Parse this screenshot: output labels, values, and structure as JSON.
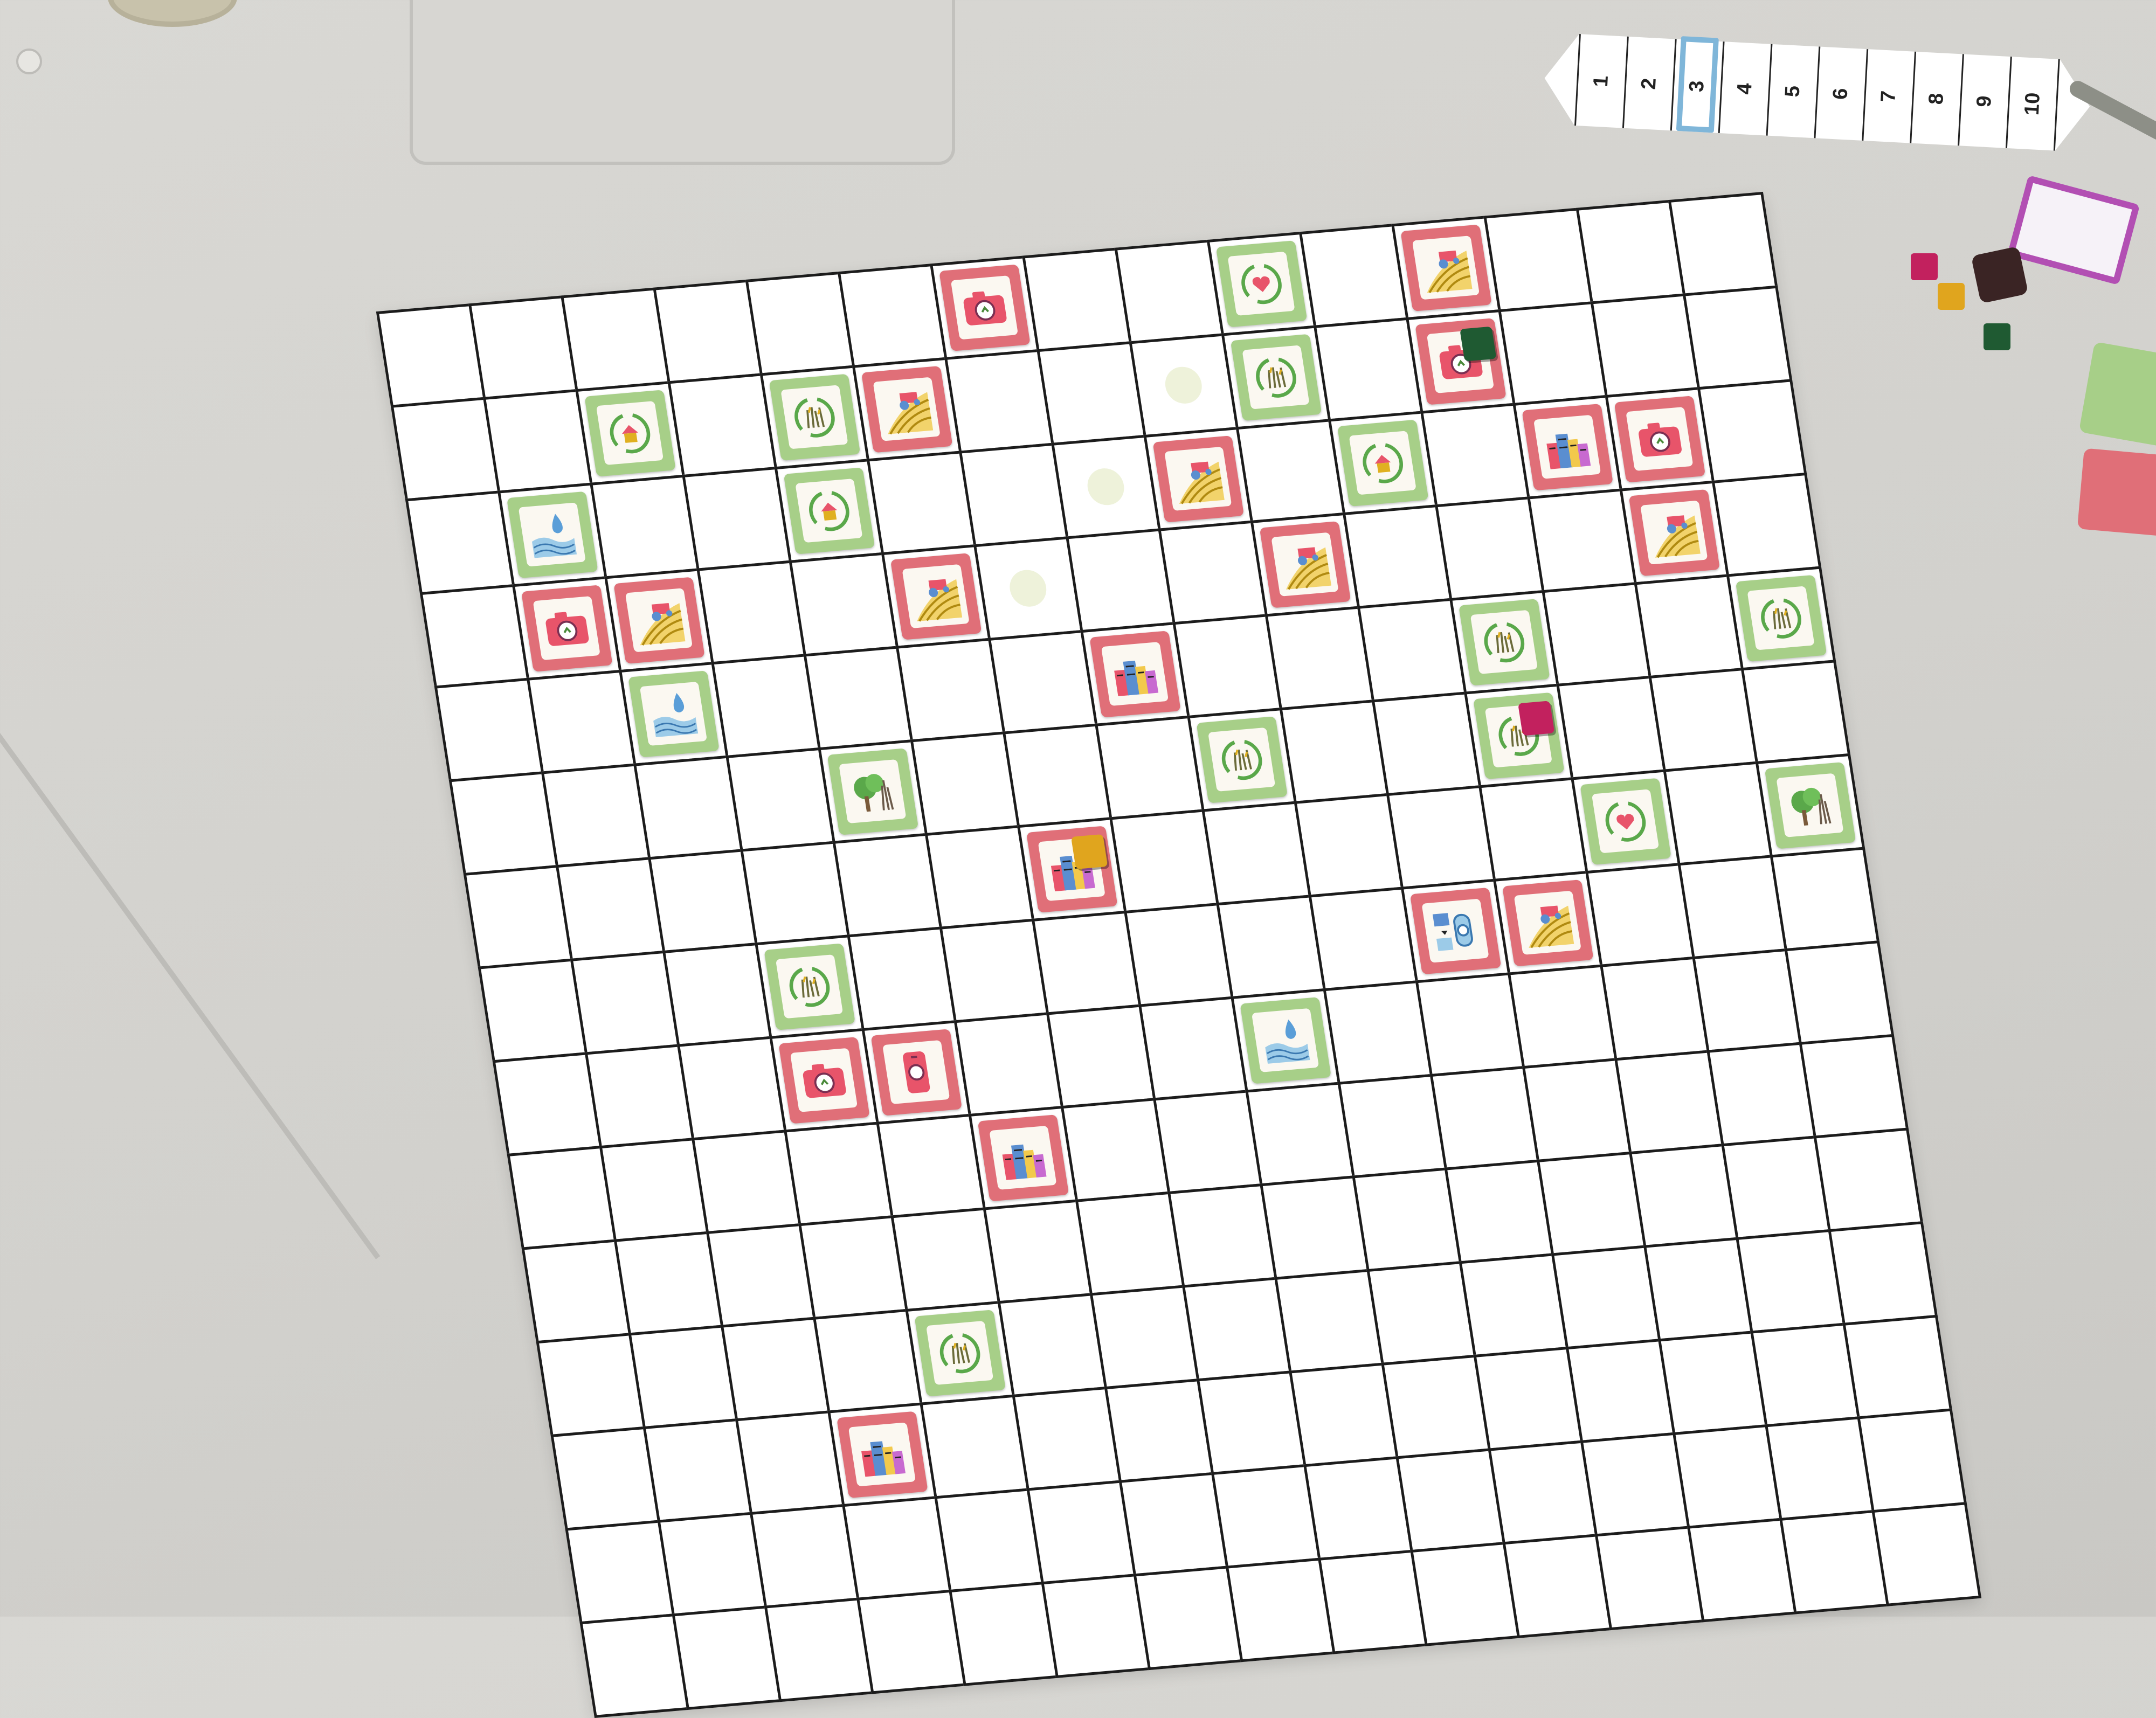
{
  "scene": {
    "description_free": true
  },
  "score_track": {
    "numbers": [
      "1",
      "2",
      "3",
      "4",
      "5",
      "6",
      "7",
      "8",
      "9",
      "10"
    ],
    "marker_on": "3",
    "marker_color": "#7fb6d9"
  },
  "board": {
    "columns": 15,
    "rows": 15,
    "tile_colors": {
      "red": "#e06f78",
      "green": "#a7cf88"
    },
    "tiles": [
      {
        "row": 0,
        "col": 6,
        "kind": "red",
        "icon": "camera-icon"
      },
      {
        "row": 0,
        "col": 9,
        "kind": "green",
        "icon": "recycle-heart-icon"
      },
      {
        "row": 0,
        "col": 11,
        "kind": "red",
        "icon": "tractor-field-icon"
      },
      {
        "row": 1,
        "col": 2,
        "kind": "green",
        "icon": "recycle-house-icon"
      },
      {
        "row": 1,
        "col": 4,
        "kind": "green",
        "icon": "recycle-grass-icon"
      },
      {
        "row": 1,
        "col": 5,
        "kind": "red",
        "icon": "tractor-field-icon"
      },
      {
        "row": 1,
        "col": 9,
        "kind": "green",
        "icon": "recycle-grass-icon"
      },
      {
        "row": 1,
        "col": 11,
        "kind": "red",
        "icon": "camera-icon"
      },
      {
        "row": 2,
        "col": 1,
        "kind": "green",
        "icon": "water-drop-icon"
      },
      {
        "row": 2,
        "col": 4,
        "kind": "green",
        "icon": "recycle-house-icon"
      },
      {
        "row": 2,
        "col": 8,
        "kind": "red",
        "icon": "tractor-field-icon"
      },
      {
        "row": 2,
        "col": 10,
        "kind": "green",
        "icon": "recycle-house-icon"
      },
      {
        "row": 2,
        "col": 12,
        "kind": "red",
        "icon": "city-buildings-icon"
      },
      {
        "row": 2,
        "col": 13,
        "kind": "red",
        "icon": "camera-icon"
      },
      {
        "row": 3,
        "col": 1,
        "kind": "red",
        "icon": "camera-icon"
      },
      {
        "row": 3,
        "col": 2,
        "kind": "red",
        "icon": "tractor-field-icon"
      },
      {
        "row": 3,
        "col": 5,
        "kind": "red",
        "icon": "tractor-field-icon"
      },
      {
        "row": 3,
        "col": 9,
        "kind": "red",
        "icon": "tractor-field-icon"
      },
      {
        "row": 3,
        "col": 13,
        "kind": "red",
        "icon": "tractor-field-icon"
      },
      {
        "row": 4,
        "col": 2,
        "kind": "green",
        "icon": "water-drop-icon"
      },
      {
        "row": 4,
        "col": 7,
        "kind": "red",
        "icon": "city-buildings-icon"
      },
      {
        "row": 4,
        "col": 11,
        "kind": "green",
        "icon": "recycle-grass-icon"
      },
      {
        "row": 4,
        "col": 14,
        "kind": "green",
        "icon": "recycle-grass-icon"
      },
      {
        "row": 5,
        "col": 4,
        "kind": "green",
        "icon": "forest-icon"
      },
      {
        "row": 5,
        "col": 8,
        "kind": "green",
        "icon": "recycle-grass-icon"
      },
      {
        "row": 5,
        "col": 11,
        "kind": "green",
        "icon": "recycle-grass-icon"
      },
      {
        "row": 6,
        "col": 6,
        "kind": "red",
        "icon": "city-buildings-icon"
      },
      {
        "row": 6,
        "col": 12,
        "kind": "green",
        "icon": "recycle-heart-icon"
      },
      {
        "row": 6,
        "col": 14,
        "kind": "green",
        "icon": "forest-icon"
      },
      {
        "row": 7,
        "col": 3,
        "kind": "green",
        "icon": "recycle-grass-icon"
      },
      {
        "row": 7,
        "col": 10,
        "kind": "red",
        "icon": "machine-diagram-icon"
      },
      {
        "row": 7,
        "col": 11,
        "kind": "red",
        "icon": "tractor-field-icon"
      },
      {
        "row": 8,
        "col": 3,
        "kind": "red",
        "icon": "camera-icon"
      },
      {
        "row": 8,
        "col": 4,
        "kind": "red",
        "icon": "phone-icon"
      },
      {
        "row": 8,
        "col": 8,
        "kind": "green",
        "icon": "water-drop-icon"
      },
      {
        "row": 9,
        "col": 5,
        "kind": "red",
        "icon": "city-buildings-icon"
      },
      {
        "row": 11,
        "col": 4,
        "kind": "green",
        "icon": "recycle-grass-icon"
      },
      {
        "row": 12,
        "col": 3,
        "kind": "red",
        "icon": "city-buildings-icon"
      }
    ],
    "markers": [
      {
        "row": 1,
        "col": 8
      },
      {
        "row": 2,
        "col": 7
      },
      {
        "row": 3,
        "col": 6
      }
    ],
    "cubes": [
      {
        "row": 1,
        "col": 11,
        "color": "#1f5a32"
      },
      {
        "row": 5,
        "col": 11,
        "color": "#c2215e"
      },
      {
        "row": 6,
        "col": 6,
        "color": "#e0a51e"
      }
    ]
  },
  "off_board": {
    "cube_colors": [
      "#c2215e",
      "#e0a51e",
      "#1f5a32"
    ],
    "die_color": "#3a2424",
    "deck_color": "#b24fb3"
  }
}
